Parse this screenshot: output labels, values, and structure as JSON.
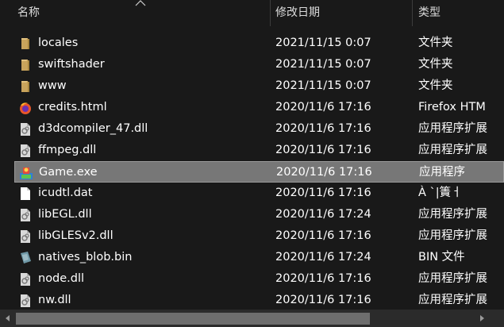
{
  "columns": {
    "name": "名称",
    "date": "修改日期",
    "type": "类型"
  },
  "rows": [
    {
      "name": "locales",
      "date": "2021/11/15 0:07",
      "type": "文件夹",
      "icon": "folder-icon"
    },
    {
      "name": "swiftshader",
      "date": "2021/11/15 0:07",
      "type": "文件夹",
      "icon": "folder-icon"
    },
    {
      "name": "www",
      "date": "2021/11/15 0:07",
      "type": "文件夹",
      "icon": "folder-icon"
    },
    {
      "name": "credits.html",
      "date": "2020/11/6 17:16",
      "type": "Firefox HTM",
      "icon": "firefox-icon"
    },
    {
      "name": "d3dcompiler_47.dll",
      "date": "2020/11/6 17:16",
      "type": "应用程序扩展",
      "icon": "dll-icon"
    },
    {
      "name": "ffmpeg.dll",
      "date": "2020/11/6 17:16",
      "type": "应用程序扩展",
      "icon": "dll-icon"
    },
    {
      "name": "Game.exe",
      "date": "2020/11/6 17:16",
      "type": "应用程序",
      "icon": "exe-icon",
      "selected": true
    },
    {
      "name": "icudtl.dat",
      "date": "2020/11/6 17:16",
      "type": "À `|簀ㅓ",
      "icon": "file-icon"
    },
    {
      "name": "libEGL.dll",
      "date": "2020/11/6 17:24",
      "type": "应用程序扩展",
      "icon": "dll-icon"
    },
    {
      "name": "libGLESv2.dll",
      "date": "2020/11/6 17:16",
      "type": "应用程序扩展",
      "icon": "dll-icon"
    },
    {
      "name": "natives_blob.bin",
      "date": "2020/11/6 17:24",
      "type": "BIN 文件",
      "icon": "bin-icon"
    },
    {
      "name": "node.dll",
      "date": "2020/11/6 17:16",
      "type": "应用程序扩展",
      "icon": "dll-icon"
    },
    {
      "name": "nw.dll",
      "date": "2020/11/6 17:16",
      "type": "应用程序扩展",
      "icon": "dll-icon"
    }
  ],
  "colors": {
    "background": "#191919",
    "selected": "#777777",
    "folder": "#d8b26b"
  }
}
